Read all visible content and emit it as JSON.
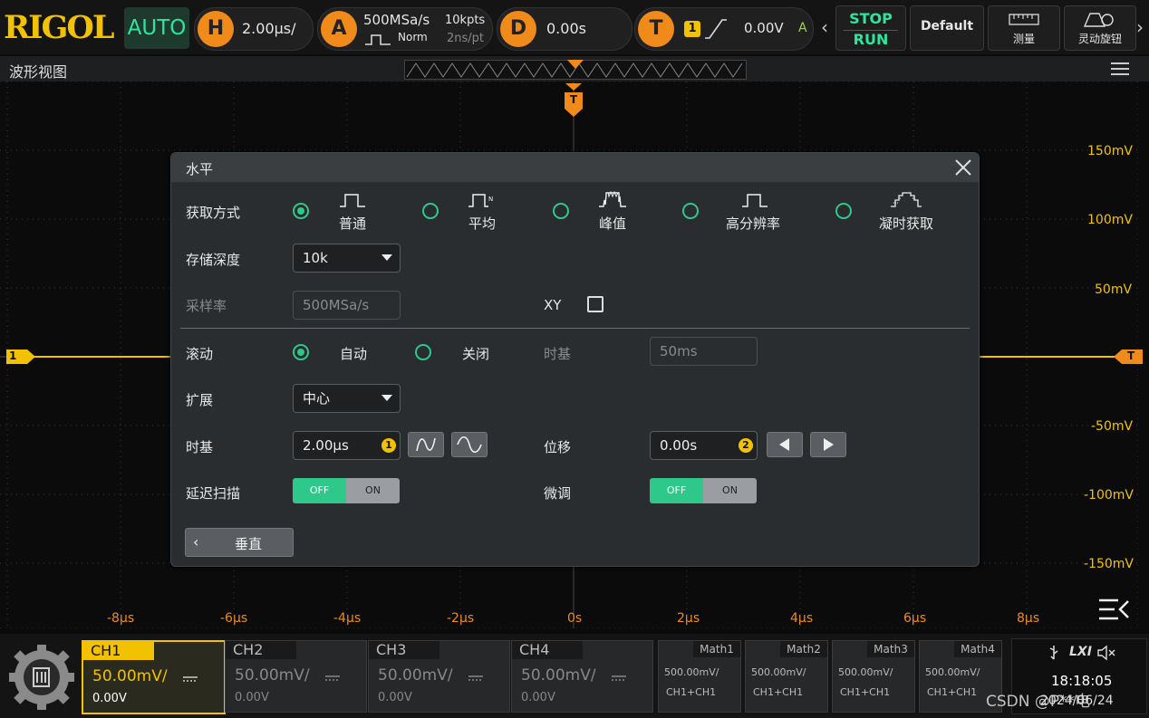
{
  "topbar": {
    "brand": "RIGOL",
    "mode": "AUTO",
    "h_letter": "H",
    "timebase": "2.00µs/",
    "a_letter": "A",
    "sample_rate": "500MSa/s",
    "acq_mode": "Norm",
    "mem_depth": "10kpts",
    "per_pt": "2ns/pt",
    "d_letter": "D",
    "delay": "0.00s",
    "t_letter": "T",
    "trig_src": "1",
    "trig_level": "0.00V",
    "trig_mode": "A",
    "stop_label": "STOP",
    "run_label": "RUN",
    "default_label": "Default",
    "measure_label": "测量",
    "knob_label": "灵动旋钮"
  },
  "waveform": {
    "title": "波形视图",
    "trigger_marker": "T",
    "ch1_marker": "1",
    "right_trig_marker": "T",
    "volt_labels": [
      "150mV",
      "100mV",
      "50mV",
      "-50mV",
      "-100mV",
      "-150mV"
    ],
    "time_labels": [
      "-8µs",
      "-6µs",
      "-4µs",
      "-2µs",
      "0s",
      "2µs",
      "4µs",
      "6µs",
      "8µs"
    ]
  },
  "dialog": {
    "title": "水平",
    "acq_label": "获取方式",
    "acq_options": [
      "普通",
      "平均",
      "峰值",
      "高分辨率",
      "凝时获取"
    ],
    "acq_selected": 0,
    "mem_label": "存储深度",
    "mem_value": "10k",
    "sr_label": "采样率",
    "sr_value": "500MSa/s",
    "xy_label": "XY",
    "roll_label": "滚动",
    "roll_auto": "自动",
    "roll_off": "关闭",
    "roll_tb_label": "时基",
    "roll_tb_value": "50ms",
    "expand_label": "扩展",
    "expand_value": "中心",
    "tb_label": "时基",
    "tb_value": "2.00µs",
    "tb_knob": "1",
    "offset_label": "位移",
    "offset_value": "0.00s",
    "offset_knob": "2",
    "delay_label": "延迟扫描",
    "fine_label": "微调",
    "toggle_off": "OFF",
    "toggle_on": "ON",
    "back_label": "垂直"
  },
  "bottom": {
    "channels": [
      {
        "name": "CH1",
        "scale": "50.00mV/",
        "offset": "0.00V"
      },
      {
        "name": "CH2",
        "scale": "50.00mV/",
        "offset": "0.00V"
      },
      {
        "name": "CH3",
        "scale": "50.00mV/",
        "offset": "0.00V"
      },
      {
        "name": "CH4",
        "scale": "50.00mV/",
        "offset": "0.00V"
      }
    ],
    "maths": [
      {
        "name": "Math1",
        "scale": "500.00mV/",
        "src": "CH1+CH1"
      },
      {
        "name": "Math2",
        "scale": "500.00mV/",
        "src": "CH1+CH1"
      },
      {
        "name": "Math3",
        "scale": "500.00mV/",
        "src": "CH1+CH1"
      },
      {
        "name": "Math4",
        "scale": "500.00mV/",
        "src": "CH1+CH1"
      }
    ],
    "lxi": "LXI",
    "time": "18:18:05",
    "date": "2024/06/24",
    "watermark": "CSDN @P**电"
  },
  "colors": {
    "ch1": "#f2c200",
    "accent": "#2ec98a",
    "trigger": "#f08a1a"
  }
}
